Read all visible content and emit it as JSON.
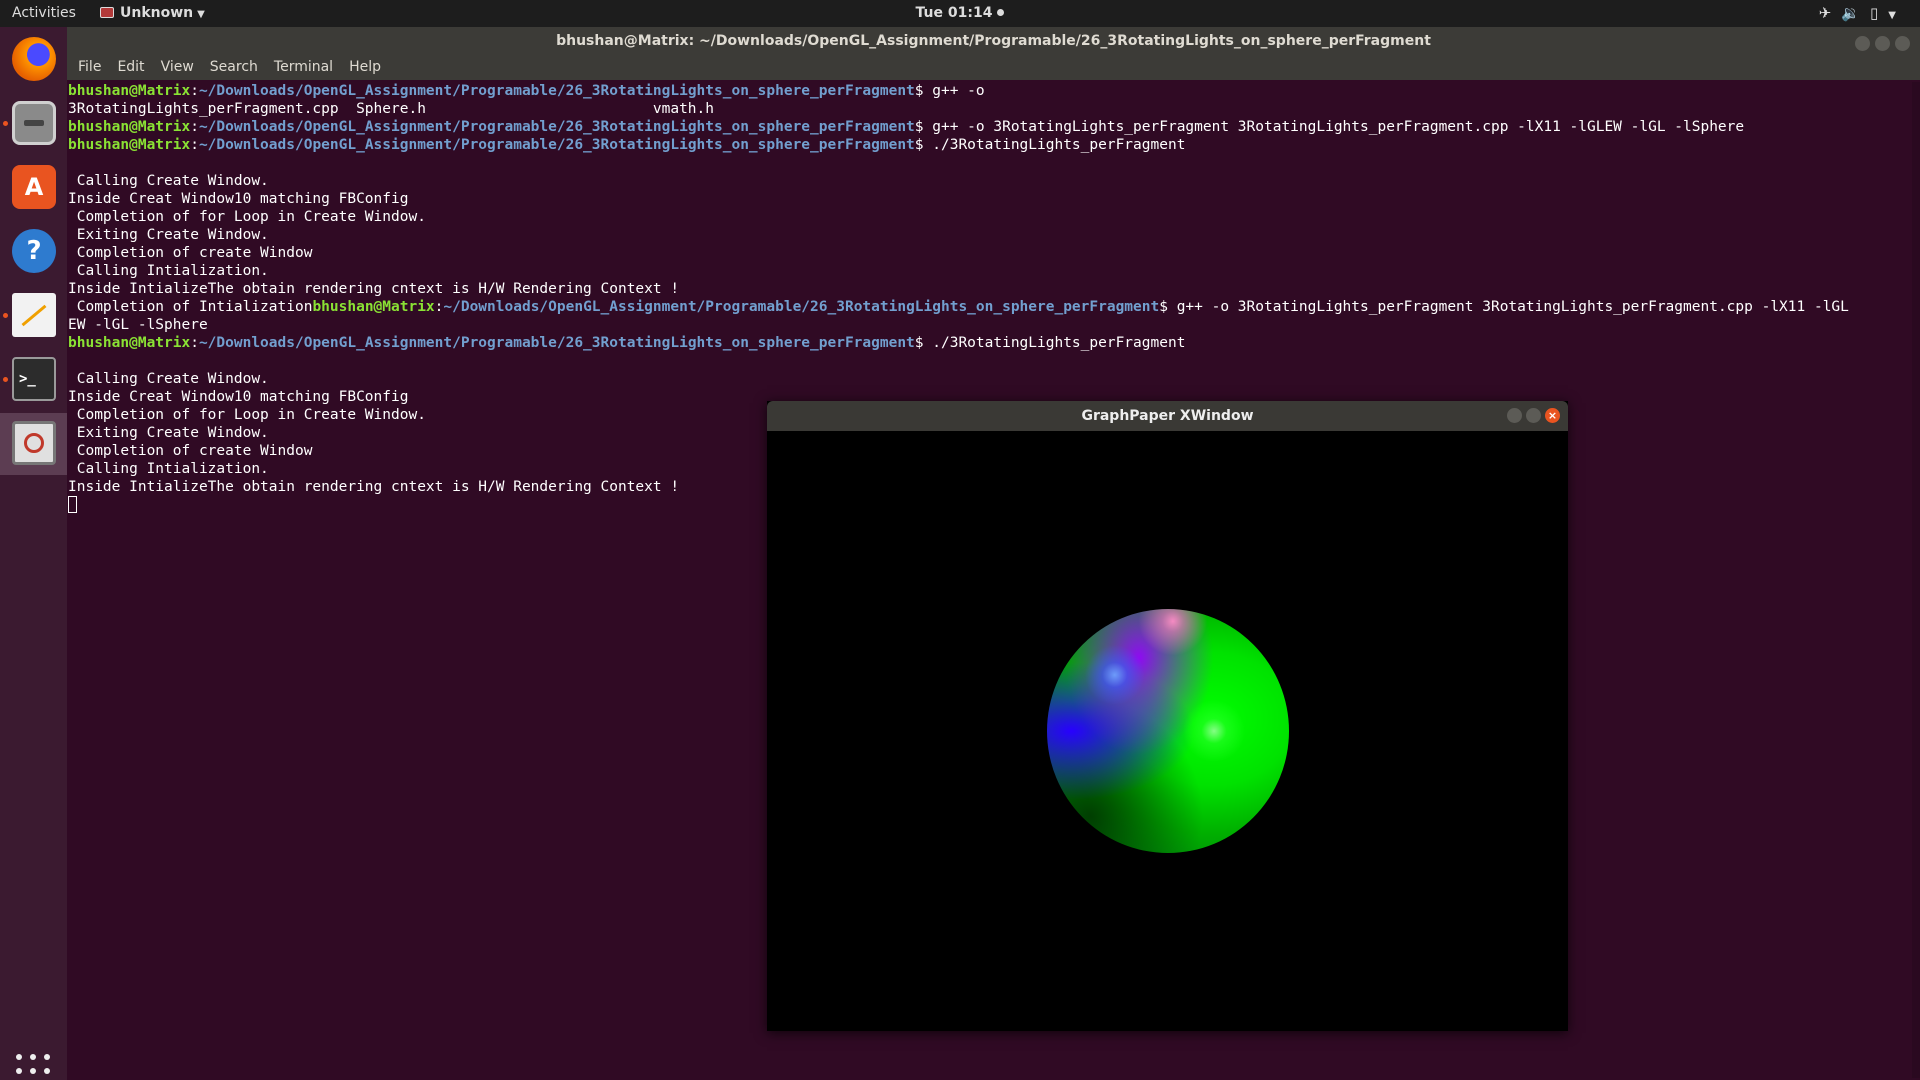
{
  "topbar": {
    "activities": "Activities",
    "app_name": "Unknown",
    "clock": "Tue 01:14",
    "tray_icons": [
      "airplane-icon",
      "volume-icon",
      "battery-icon",
      "system-menu-icon"
    ]
  },
  "dock": {
    "items": [
      {
        "name": "firefox",
        "icon": "firefox-icon",
        "color": "#e66000"
      },
      {
        "name": "files",
        "icon": "files-icon",
        "color": "#9a9a9a"
      },
      {
        "name": "software",
        "icon": "software-center-icon",
        "color": "#e95420"
      },
      {
        "name": "help",
        "icon": "help-icon",
        "color": "#2e7bcf"
      },
      {
        "name": "text-editor",
        "icon": "text-editor-icon",
        "color": "#e8e8e8"
      },
      {
        "name": "terminal",
        "icon": "terminal-icon",
        "color": "#2c2c2c"
      },
      {
        "name": "unknown-app",
        "icon": "unknown-app-icon",
        "color": "#b33a3a"
      }
    ]
  },
  "terminal": {
    "title": "bhushan@Matrix: ~/Downloads/OpenGL_Assignment/Programable/26_3RotatingLights_on_sphere_perFragment",
    "menu": [
      "File",
      "Edit",
      "View",
      "Search",
      "Terminal",
      "Help"
    ],
    "user": "bhushan@Matrix",
    "path": "~/Downloads/OpenGL_Assignment/Programable/26_3RotatingLights_on_sphere_perFragment",
    "lines": [
      {
        "type": "prompt",
        "cmd": "$ g++ -o"
      },
      {
        "type": "out",
        "text": "3RotatingLights_perFragment.cpp  Sphere.h                          vmath.h"
      },
      {
        "type": "prompt",
        "cmd": "$ g++ -o 3RotatingLights_perFragment 3RotatingLights_perFragment.cpp -lX11 -lGLEW -lGL -lSphere"
      },
      {
        "type": "prompt",
        "cmd": "$ ./3RotatingLights_perFragment"
      },
      {
        "type": "out",
        "text": ""
      },
      {
        "type": "out",
        "text": " Calling Create Window."
      },
      {
        "type": "out",
        "text": "Inside Creat Window10 matching FBConfig"
      },
      {
        "type": "out",
        "text": " Completion of for Loop in Create Window."
      },
      {
        "type": "out",
        "text": " Exiting Create Window."
      },
      {
        "type": "out",
        "text": " Completion of create Window"
      },
      {
        "type": "out",
        "text": " Calling Intialization."
      },
      {
        "type": "out",
        "text": "Inside IntializeThe obtain rendering cntext is H/W Rendering Context !"
      },
      {
        "type": "mixed",
        "pre": " Completion of Intialization",
        "cmd": "$ g++ -o 3RotatingLights_perFragment 3RotatingLights_perFragment.cpp -lX11 -lGL"
      },
      {
        "type": "out",
        "text": "EW -lGL -lSphere"
      },
      {
        "type": "prompt",
        "cmd": "$ ./3RotatingLights_perFragment"
      },
      {
        "type": "out",
        "text": ""
      },
      {
        "type": "out",
        "text": " Calling Create Window."
      },
      {
        "type": "out",
        "text": "Inside Creat Window10 matching FBConfig"
      },
      {
        "type": "out",
        "text": " Completion of for Loop in Create Window."
      },
      {
        "type": "out",
        "text": " Exiting Create Window."
      },
      {
        "type": "out",
        "text": " Completion of create Window"
      },
      {
        "type": "out",
        "text": " Calling Intialization."
      },
      {
        "type": "out",
        "text": "Inside IntializeThe obtain rendering cntext is H/W Rendering Context !"
      }
    ]
  },
  "graphpaper": {
    "title": "GraphPaper XWindow"
  },
  "colors": {
    "terminal_bg": "#300a24",
    "prompt_user": "#8ae234",
    "prompt_path": "#729fcf",
    "accent": "#e95420"
  }
}
